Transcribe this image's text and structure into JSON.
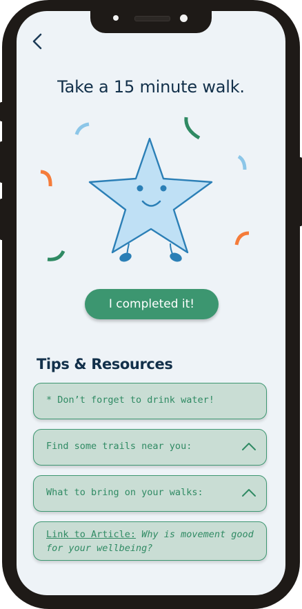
{
  "screen": {
    "title": "Take a 15 minute walk.",
    "complete_button_label": "I completed it!",
    "section_title": "Tips & Resources"
  },
  "tips": [
    {
      "label": "* Don’t forget to drink water!",
      "expandable": false
    },
    {
      "label": "Find some trails near you:",
      "expandable": true
    },
    {
      "label": "What to bring on your walks:",
      "expandable": true
    }
  ],
  "article": {
    "link_label": "Link to Article:",
    "link_title": "Why is movement good for your wellbeing?"
  },
  "icons": {
    "back": "chevron-left-icon",
    "expand": "chevron-up-icon",
    "mascot": "smiling-star-mascot"
  },
  "colors": {
    "screen_bg": "#eef3f7",
    "primary_green": "#3c9670",
    "card_bg": "#c9ddd4",
    "title_navy": "#12304a",
    "star_fill": "#bfe0f5",
    "star_stroke": "#2b7fb6",
    "confetti_orange": "#f57c3a",
    "confetti_green": "#2f8a63",
    "confetti_blue": "#8cc6e8"
  }
}
